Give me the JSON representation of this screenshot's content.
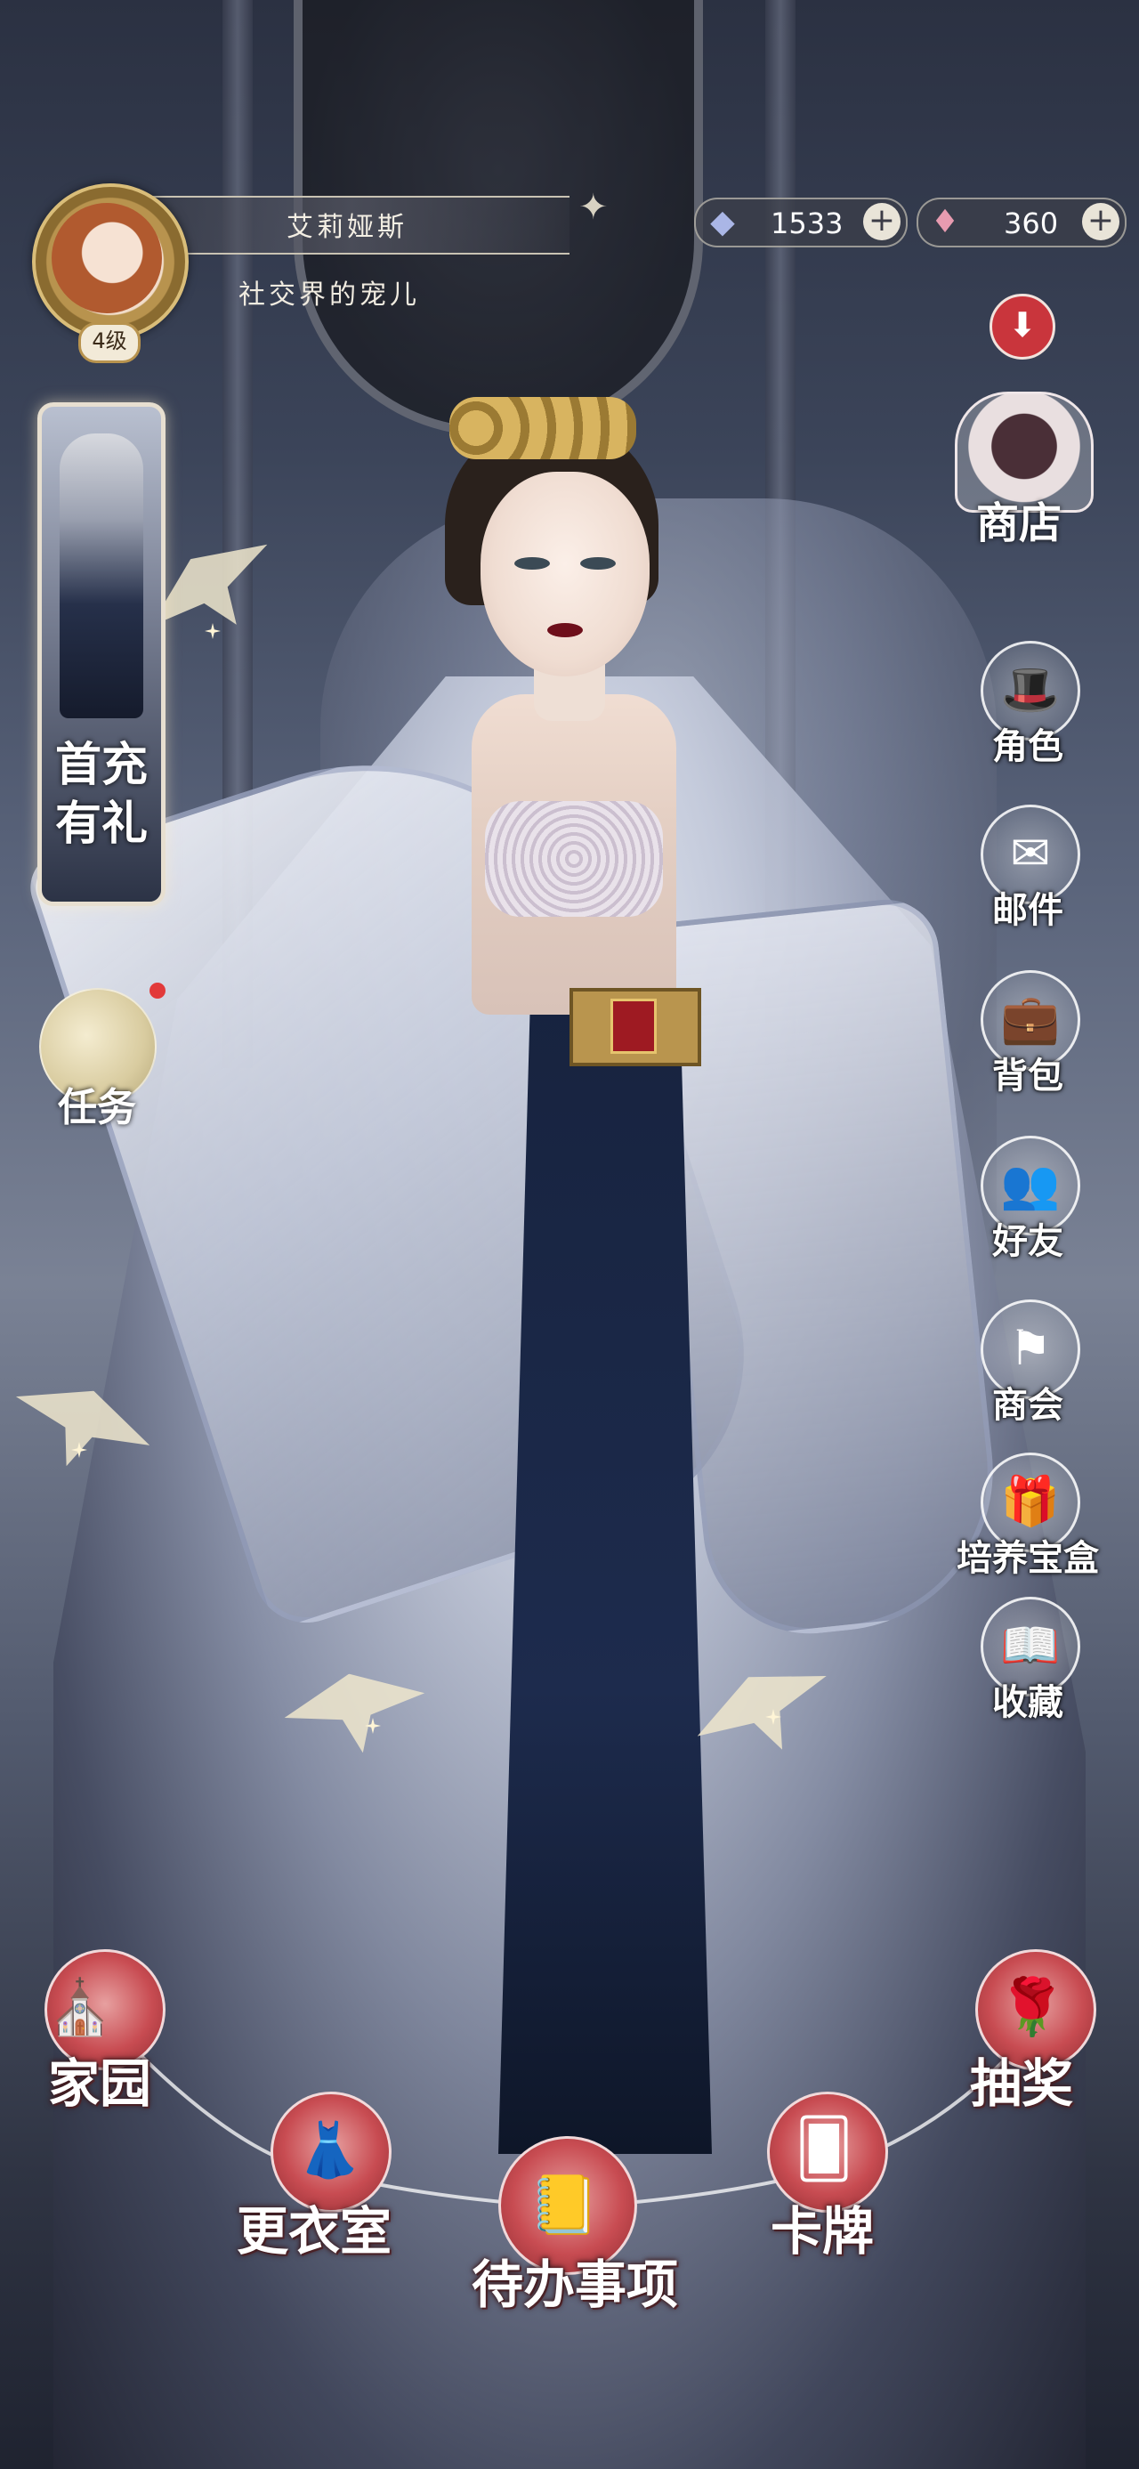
{
  "player": {
    "name": "艾莉娅斯",
    "title": "社交界的宠儿",
    "level": "4级"
  },
  "currency": [
    {
      "icon": "crystal-icon",
      "value": "1533",
      "plus": "+",
      "color": "#aab6e6"
    },
    {
      "icon": "ruby-icon",
      "value": "360",
      "plus": "+",
      "color": "#e79bb0"
    }
  ],
  "download_glyph": "⬇",
  "shop_label": "商店",
  "promo_label": "首充有礼",
  "task_label": "任务",
  "menu": [
    {
      "id": "character",
      "label": "角色",
      "icon": "top-hat-icon",
      "glyph": "🎩"
    },
    {
      "id": "mail",
      "label": "邮件",
      "icon": "envelope-icon",
      "glyph": "✉"
    },
    {
      "id": "bag",
      "label": "背包",
      "icon": "briefcase-icon",
      "glyph": "💼"
    },
    {
      "id": "friends",
      "label": "好友",
      "icon": "friends-icon",
      "glyph": "👥"
    },
    {
      "id": "guild",
      "label": "商会",
      "icon": "banner-icon",
      "glyph": "⚑"
    },
    {
      "id": "growth-box",
      "label": "培养宝盒",
      "icon": "gift-box-icon",
      "glyph": "🎁"
    },
    {
      "id": "collection",
      "label": "收藏",
      "icon": "book-icon",
      "glyph": "📖"
    }
  ],
  "bottom_nav": [
    {
      "id": "home",
      "label": "家园",
      "icon": "window-arch-icon",
      "glyph": "⛪"
    },
    {
      "id": "wardrobe",
      "label": "更衣室",
      "icon": "dress-form-icon",
      "glyph": "👗"
    },
    {
      "id": "todo",
      "label": "待办事项",
      "icon": "calendar-book-icon",
      "glyph": "📒"
    },
    {
      "id": "cards",
      "label": "卡牌",
      "icon": "card-silhouette-icon",
      "glyph": "🂠"
    },
    {
      "id": "gacha",
      "label": "抽奖",
      "icon": "rose-icon",
      "glyph": "🌹"
    }
  ],
  "colors": {
    "accent_red": "#c84c52",
    "notification_red": "#e23a3a",
    "gold": "#b8934e"
  }
}
